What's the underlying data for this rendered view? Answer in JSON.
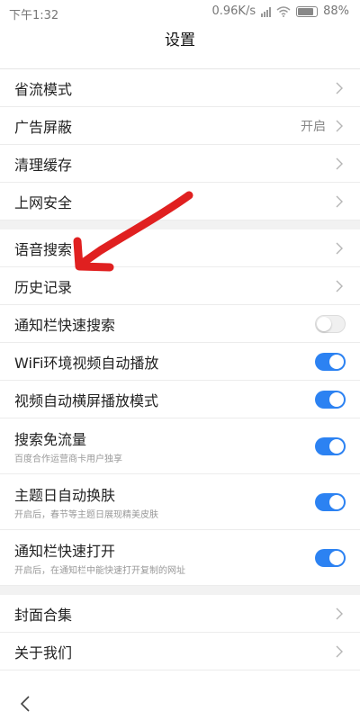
{
  "status_bar": {
    "time": "下午1:32",
    "speed": "0.96K/s",
    "battery": "88%"
  },
  "header": {
    "title": "设置"
  },
  "groups": [
    [
      {
        "label": "省流模式",
        "type": "arrow"
      },
      {
        "label": "广告屏蔽",
        "type": "arrow",
        "value": "开启"
      },
      {
        "label": "清理缓存",
        "type": "arrow"
      },
      {
        "label": "上网安全",
        "type": "arrow"
      }
    ],
    [
      {
        "label": "语音搜索",
        "type": "arrow"
      },
      {
        "label": "历史记录",
        "type": "arrow"
      },
      {
        "label": "通知栏快速搜索",
        "type": "toggle",
        "on": false
      },
      {
        "label": "WiFi环境视频自动播放",
        "type": "toggle",
        "on": true
      },
      {
        "label": "视频自动横屏播放模式",
        "type": "toggle",
        "on": true
      },
      {
        "label": "搜索免流量",
        "type": "toggle",
        "on": true,
        "sub": "百度合作运营商卡用户独享"
      },
      {
        "label": "主题日自动换肤",
        "type": "toggle",
        "on": true,
        "sub": "开启后，春节等主题日展现精美皮肤"
      },
      {
        "label": "通知栏快速打开",
        "type": "toggle",
        "on": true,
        "sub": "开启后，在通知栏中能快速打开复制的网址"
      }
    ],
    [
      {
        "label": "封面合集",
        "type": "arrow"
      },
      {
        "label": "关于我们",
        "type": "arrow"
      }
    ]
  ],
  "colors": {
    "accent": "#2c82f2",
    "annotation": "#e02020"
  },
  "icons": {
    "back": "back-icon",
    "chevron": "chevron-right-icon"
  }
}
